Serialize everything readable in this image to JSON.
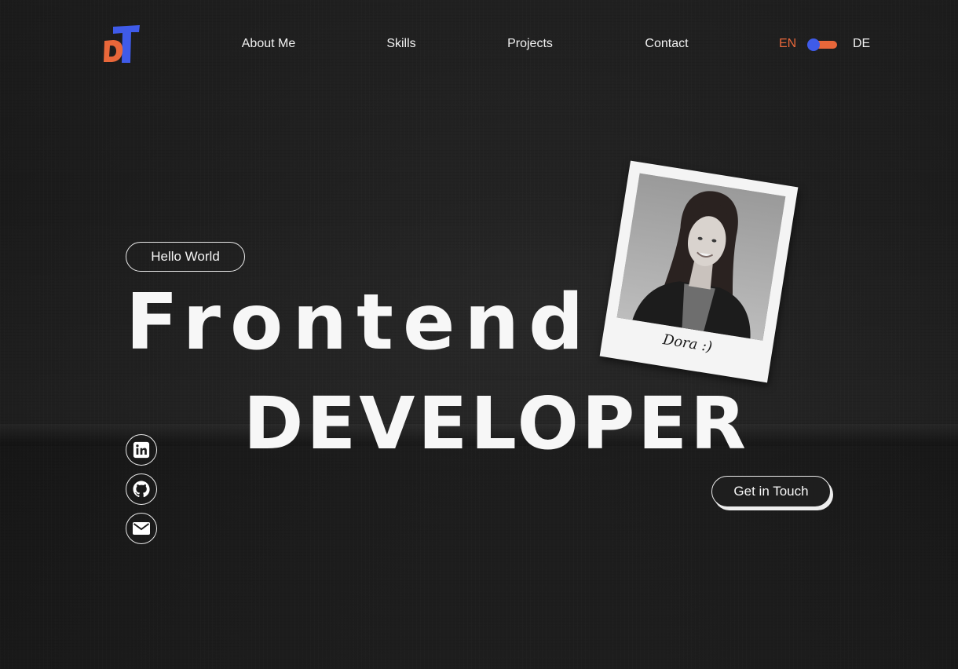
{
  "header": {
    "logo": {
      "letters": "DT",
      "colors": {
        "d": "#e8673a",
        "t": "#3f5be9"
      }
    },
    "nav": [
      {
        "label": "About Me"
      },
      {
        "label": "Skills"
      },
      {
        "label": "Projects"
      },
      {
        "label": "Contact"
      }
    ],
    "language": {
      "left_label": "EN",
      "right_label": "DE",
      "selected": "EN",
      "active_color": "#e8673a",
      "knob_color": "#3f5be9"
    }
  },
  "hero": {
    "badge": "Hello World",
    "title_line_1": "Frontend",
    "title_line_2": "DEVELOPER",
    "cta_label": "Get in Touch"
  },
  "polaroid": {
    "caption": "Dora :)"
  },
  "socials": [
    {
      "icon": "linkedin-icon"
    },
    {
      "icon": "github-icon"
    },
    {
      "icon": "mail-icon"
    }
  ],
  "colors": {
    "background": "#1c1c1c",
    "text": "#f7f7f7",
    "accent_orange": "#e8673a",
    "accent_blue": "#3f5be9"
  }
}
